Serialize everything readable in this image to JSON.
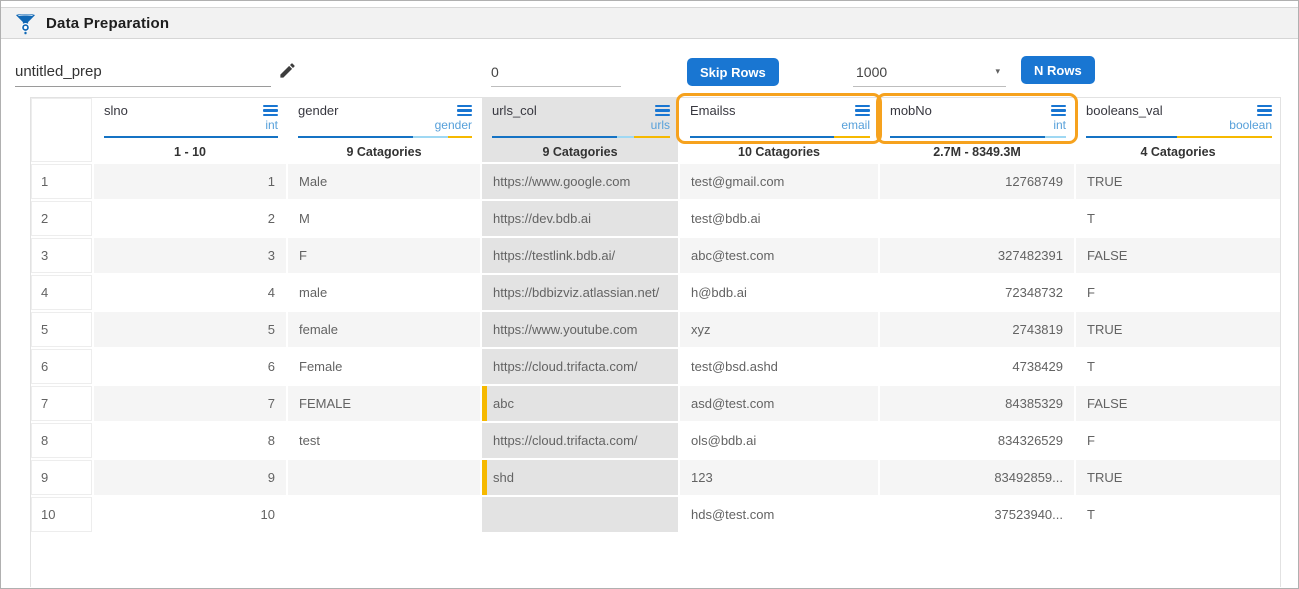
{
  "header": {
    "title": "Data Preparation"
  },
  "toolbar": {
    "prep_name": "untitled_prep",
    "skip_rows_value": "0",
    "skip_rows_label": "Skip Rows",
    "n_rows_value": "1000",
    "n_rows_label": "N Rows"
  },
  "icons": {
    "logo": "funnel-icon",
    "edit": "pencil-icon",
    "column_menu": "hamburger-menu-icon",
    "dropdown": "caret-down-icon"
  },
  "colors": {
    "primary_blue": "#1976d2",
    "bar_dark_blue": "#1573c4",
    "bar_light_blue": "#9fd8f3",
    "bar_yellow": "#f6b900",
    "highlight_orange": "#f6a21e",
    "selected_column_gray": "#e3e3e3"
  },
  "table": {
    "columns": [
      {
        "name": "slno",
        "type": "int",
        "summary": "1 - 10",
        "align": "right",
        "bar": [
          {
            "color": "dark",
            "pct": 100
          }
        ]
      },
      {
        "name": "gender",
        "type": "gender",
        "summary": "9 Catagories",
        "align": "left",
        "bar": [
          {
            "color": "dark",
            "pct": 66
          },
          {
            "color": "light",
            "pct": 20
          },
          {
            "color": "yellow",
            "pct": 14
          }
        ]
      },
      {
        "name": "urls_col",
        "type": "urls",
        "summary": "9 Catagories",
        "align": "left",
        "selected": true,
        "bar": [
          {
            "color": "dark",
            "pct": 70
          },
          {
            "color": "light",
            "pct": 10
          },
          {
            "color": "yellow",
            "pct": 20
          }
        ]
      },
      {
        "name": "Emailss",
        "type": "email",
        "summary": "10 Catagories",
        "align": "left",
        "highlighted": true,
        "bar": [
          {
            "color": "dark",
            "pct": 80
          },
          {
            "color": "yellow",
            "pct": 20
          }
        ]
      },
      {
        "name": "mobNo",
        "type": "int",
        "summary": "2.7M - 8349.3M",
        "align": "right",
        "highlighted": true,
        "bar": [
          {
            "color": "dark",
            "pct": 88
          },
          {
            "color": "light",
            "pct": 12
          }
        ]
      },
      {
        "name": "booleans_val",
        "type": "boolean",
        "summary": "4 Catagories",
        "align": "left",
        "bar": [
          {
            "color": "dark",
            "pct": 49
          },
          {
            "color": "yellow",
            "pct": 51
          }
        ]
      }
    ],
    "rows": [
      {
        "num": "1",
        "cells": [
          "1",
          "Male",
          "https://www.google.com",
          "test@gmail.com",
          "12768749",
          "TRUE"
        ]
      },
      {
        "num": "2",
        "cells": [
          "2",
          "M",
          "https://dev.bdb.ai",
          "test@bdb.ai",
          "",
          "T"
        ]
      },
      {
        "num": "3",
        "cells": [
          "3",
          "F",
          "https://testlink.bdb.ai/",
          "abc@test.com",
          "327482391",
          "FALSE"
        ]
      },
      {
        "num": "4",
        "cells": [
          "4",
          "male",
          "https://bdbizviz.atlassian.net/",
          "h@bdb.ai",
          "72348732",
          "F"
        ]
      },
      {
        "num": "5",
        "cells": [
          "5",
          "female",
          "https://www.youtube.com",
          "xyz",
          "2743819",
          "TRUE"
        ]
      },
      {
        "num": "6",
        "cells": [
          "6",
          "Female",
          "https://cloud.trifacta.com/",
          "test@bsd.ashd",
          "4738429",
          "T"
        ]
      },
      {
        "num": "7",
        "cells": [
          "7",
          "FEMALE",
          "abc",
          "asd@test.com",
          "84385329",
          "FALSE"
        ]
      },
      {
        "num": "8",
        "cells": [
          "8",
          "test",
          "https://cloud.trifacta.com/",
          "ols@bdb.ai",
          "834326529",
          "F"
        ]
      },
      {
        "num": "9",
        "cells": [
          "9",
          "",
          "shd",
          "123",
          "83492859...",
          "TRUE"
        ]
      },
      {
        "num": "10",
        "cells": [
          "10",
          "",
          "",
          "hds@test.com",
          "37523940...",
          "T"
        ]
      }
    ],
    "invalid_cell_markers": [
      {
        "row": 7,
        "column": "urls_col"
      },
      {
        "row": 9,
        "column": "urls_col"
      }
    ]
  }
}
